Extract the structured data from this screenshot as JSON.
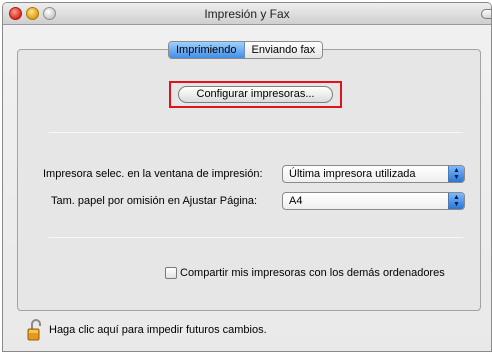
{
  "window": {
    "title": "Impresión y Fax"
  },
  "tabs": [
    {
      "label": "Imprimiendo",
      "active": true
    },
    {
      "label": "Enviando fax",
      "active": false
    }
  ],
  "config_button": {
    "label": "Configurar impresoras..."
  },
  "settings": {
    "selected_printer_label": "Impresora selec. en la ventana de impresión:",
    "selected_printer_value": "Última impresora utilizada",
    "paper_size_label": "Tam. papel por omisión en Ajustar Página:",
    "paper_size_value": "A4"
  },
  "share": {
    "label": "Compartir mis impresoras con los demás ordenadores",
    "checked": false
  },
  "lock": {
    "label": "Haga clic aquí para impedir futuros cambios.",
    "icon": "lock-open-icon"
  },
  "colors": {
    "highlight": "#e0121a",
    "accent": "#3f8fe6"
  }
}
